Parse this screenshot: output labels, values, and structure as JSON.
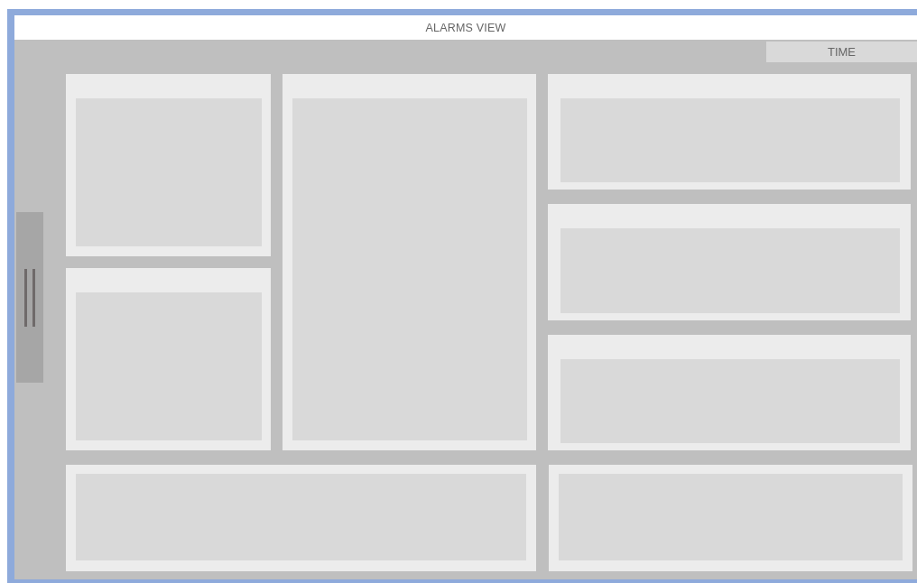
{
  "window": {
    "title": "ALARMS VIEW"
  },
  "header": {
    "time": "TIME"
  }
}
